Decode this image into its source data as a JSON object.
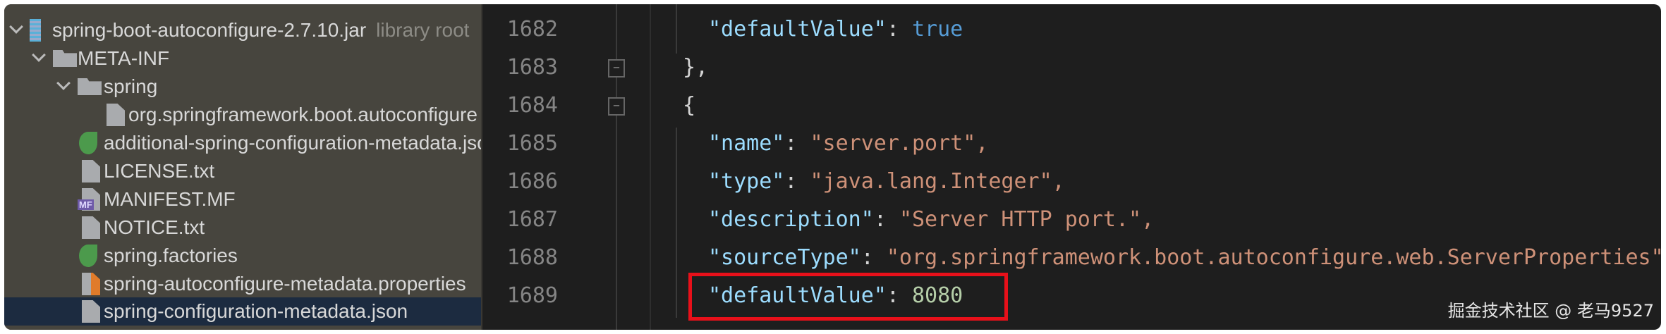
{
  "project_tree": {
    "root": {
      "label": "spring-boot-autoconfigure-2.7.10.jar",
      "hint": "library root"
    },
    "items": [
      {
        "label": "META-INF",
        "type": "folder"
      },
      {
        "label": "spring",
        "type": "folder"
      },
      {
        "label": "org.springframework.boot.autoconfigure",
        "type": "file"
      },
      {
        "label": "additional-spring-configuration-metadata.json",
        "type": "json"
      },
      {
        "label": "LICENSE.txt",
        "type": "text"
      },
      {
        "label": "MANIFEST.MF",
        "type": "manifest",
        "badge": "MF"
      },
      {
        "label": "NOTICE.txt",
        "type": "text"
      },
      {
        "label": "spring.factories",
        "type": "spring"
      },
      {
        "label": "spring-autoconfigure-metadata.properties",
        "type": "properties"
      },
      {
        "label": "spring-configuration-metadata.json",
        "type": "json",
        "selected": true
      }
    ]
  },
  "editor": {
    "line_numbers": [
      "1682",
      "1683",
      "1684",
      "1685",
      "1686",
      "1687",
      "1688",
      "1689"
    ],
    "lines": [
      {
        "key": "\"defaultValue\"",
        "value": "true"
      },
      {
        "text": "},"
      },
      {
        "text": "{"
      },
      {
        "key": "\"name\"",
        "value": "\"server.port\","
      },
      {
        "key": "\"type\"",
        "value": "\"java.lang.Integer\","
      },
      {
        "key": "\"description\"",
        "value": "\"Server HTTP port.\","
      },
      {
        "key": "\"sourceType\"",
        "value": "\"org.springframework.boot.autoconfigure.web.ServerProperties\","
      },
      {
        "key": "\"defaultValue\"",
        "value": "8080"
      }
    ],
    "highlight_color": "#e8101a"
  },
  "watermark": "掘金技术社区 @ 老马9527"
}
